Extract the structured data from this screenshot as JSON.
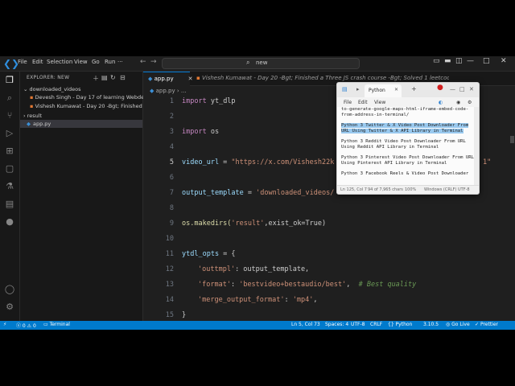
{
  "titlebar": {
    "menu": [
      "File",
      "Edit",
      "Selection",
      "View",
      "Go",
      "Run"
    ],
    "search_text": "new"
  },
  "sidebar": {
    "title": "EXPLORER: NEW",
    "items": [
      {
        "label": "downloaded_videos"
      },
      {
        "label": "Devesh Singh - Day 17 of learning Webdev!..."
      },
      {
        "label": "Vishesh Kumawat - Day 20 -Bgt; Finished a..."
      },
      {
        "label": "result"
      },
      {
        "label": "app.py"
      }
    ]
  },
  "tabs": [
    {
      "label": "app.py"
    },
    {
      "label": "Vishesh Kumawat - Day 20 -Bgt; Finished a Three JS crash course -Bgt; Solved 1 leetcode...mp4"
    }
  ],
  "breadcrumb": {
    "file": "app.py",
    "sep": "›",
    "more": "..."
  },
  "code": {
    "line_numbers": [
      "1",
      "2",
      "3",
      "4",
      "5",
      "6",
      "7",
      "8",
      "9",
      "10",
      "11",
      "12",
      "13",
      "14",
      "15"
    ],
    "l1_kw": "import",
    "l1_rest": " yt_dlp",
    "l3_kw": "import",
    "l3_rest": " os",
    "l5_var": "video_url",
    "l5_eq": " = ",
    "l5_str": "\"https://x.com/Vishesh22k",
    "l5_tail": "1\"",
    "l7_var": "output_template",
    "l7_eq": " = ",
    "l7_str": "'downloaded_videos/",
    "l9_fn": "os.makedirs(",
    "l9_str": "'result'",
    "l9_rest": ",exist_ok=True)",
    "l11_var": "ytdl_opts",
    "l11_rest": " = {",
    "l12_key": "'outtmpl'",
    "l12_rest": ": output_template,",
    "l13_key": "'format'",
    "l13_sep": ": ",
    "l13_val": "'bestvideo+bestaudio/best'",
    "l13_comma": ",  ",
    "l13_cm": "# Best quality",
    "l14_key": "'merge_output_format'",
    "l14_sep": ": ",
    "l14_val": "'mp4'",
    "l14_comma": ",",
    "l15": "}"
  },
  "notepad": {
    "tab_label": "Python",
    "menu": [
      "File",
      "Edit",
      "View"
    ],
    "lines": [
      "to-generate-google-maps-html-iframe-embed-code-",
      "from-address-in-terminal/",
      "Python 3 Twitter & X Video Post Downloader From",
      "URL Using Twitter & X API Library in Terminal",
      "Python 3 Reddit Video Post Downloader From URL",
      "Using Reddit API Library in Terminal",
      "Python 3 Pinterest Video Post Downloader From URL",
      "Using Pinterest API Library in Terminal",
      "Python 3 Facebook Reels & Video Post Downloader"
    ],
    "status": [
      "Ln 125, Col 7",
      "94 of 7,965 chars",
      "100%",
      "Windows (CRLF)",
      "UTF-8"
    ]
  },
  "statusbar": {
    "errors": "0",
    "warnings": "0",
    "terminal": "Terminal",
    "position": "Ln 5, Col 73",
    "spaces": "Spaces: 4",
    "encoding": "UTF-8",
    "eol": "CRLF",
    "language": "Python",
    "version": "3.10.5",
    "golive": "Go Live",
    "prettier": "Prettier"
  },
  "colors": {
    "accent": "#007acc",
    "editor_bg": "#1f1f1f",
    "highlight": "#99c9ef"
  }
}
